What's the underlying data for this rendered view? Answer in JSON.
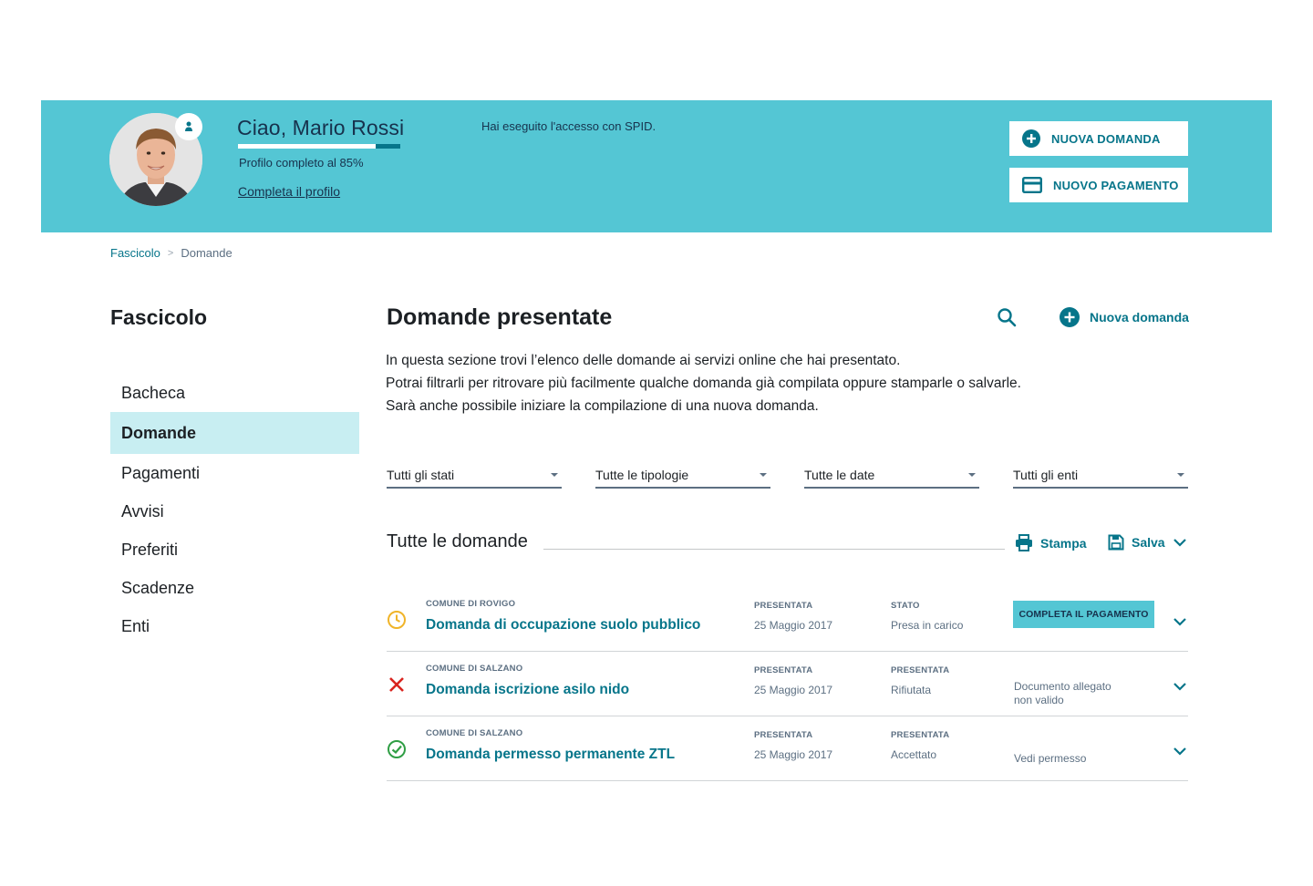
{
  "header": {
    "greeting": "Ciao, Mario Rossi",
    "profile_progress": 0.85,
    "profile_completion_text": "Profilo completo al 85%",
    "complete_profile_link": "Completa il profilo",
    "spid_text": "Hai eseguito l'accesso con SPID.",
    "new_request_button": "NUOVA DOMANDA",
    "new_payment_button": "NUOVO PAGAMENTO"
  },
  "breadcrumb": {
    "parent": "Fascicolo",
    "separator": ">",
    "current": "Domande"
  },
  "sidebar": {
    "title": "Fascicolo",
    "items": [
      {
        "label": "Bacheca",
        "active": false
      },
      {
        "label": "Domande",
        "active": true
      },
      {
        "label": "Pagamenti",
        "active": false
      },
      {
        "label": "Avvisi",
        "active": false
      },
      {
        "label": "Preferiti",
        "active": false
      },
      {
        "label": "Scadenze",
        "active": false
      },
      {
        "label": "Enti",
        "active": false
      }
    ]
  },
  "main": {
    "title": "Domande presentate",
    "new_request_link": "Nuova domanda",
    "intro_lines": [
      "In questa sezione trovi l’elenco delle domande ai servizi online che hai presentato.",
      "Potrai filtrarli per ritrovare più facilmente qualche domanda già compilata oppure stamparle o salvarle.",
      "Sarà anche possibile iniziare la compilazione di una nuova domanda."
    ],
    "filters": [
      "Tutti gli stati",
      "Tutte le tipologie",
      "Tutte le date",
      "Tutti gli enti"
    ],
    "list_title": "Tutte le domande",
    "print_label": "Stampa",
    "save_label": "Salva",
    "rows": [
      {
        "status_icon": "clock-icon",
        "ente": "COMUNE DI ROVIGO",
        "title": "Domanda di occupazione suolo pubblico",
        "col1_label": "PRESENTATA",
        "col1_value": "25 Maggio 2017",
        "col2_label": "STATO",
        "col2_value": "Presa in carico",
        "action_button": "COMPLETA IL PAGAMENTO"
      },
      {
        "status_icon": "cross-icon",
        "ente": "COMUNE DI SALZANO",
        "title": "Domanda iscrizione asilo nido",
        "col1_label": "PRESENTATA",
        "col1_value": "25 Maggio 2017",
        "col2_label": "PRESENTATA",
        "col2_value": "Rifiutata",
        "note_line1": "Documento allegato",
        "note_line2": "non valido"
      },
      {
        "status_icon": "check-circle-icon",
        "ente": "COMUNE DI SALZANO",
        "title": "Domanda permesso permanente ZTL",
        "col1_label": "PRESENTATA",
        "col1_value": "25 Maggio 2017",
        "col2_label": "PRESENTATA",
        "col2_value": "Accettato",
        "note": "Vedi permesso"
      }
    ]
  },
  "colors": {
    "header_bg": "#54c6d4",
    "primary": "#06758a",
    "active_nav_bg": "#c8eef2",
    "pending": "#f0b429",
    "rejected": "#d9231e",
    "accepted": "#2f9e44"
  }
}
